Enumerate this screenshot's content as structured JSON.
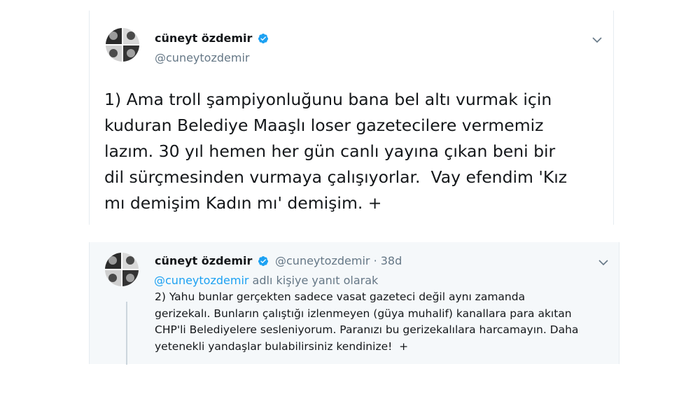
{
  "main_tweet": {
    "name": "cüneyt özdemir",
    "handle": "@cuneytozdemir",
    "text": "1) Ama troll şampiyonluğunu bana bel altı vurmak için\nkuduran Belediye Maaşlı loser gazetecilere vermemiz\nlazım. 30 yıl hemen her gün canlı yayına çıkan beni bir\ndil sürçmesinden vurmaya çalışıyorlar.  Vay efendim 'Kız\nmı demişim Kadın mı' demişim. +",
    "icons": [
      "avatar",
      "verified-badge-icon",
      "chevron-down-icon"
    ]
  },
  "reply_tweet": {
    "name": "cüneyt özdemir",
    "handle": "@cuneytozdemir",
    "separator": "·",
    "time": "38d",
    "reply_to_handle": "@cuneytozdemir",
    "reply_to_suffix": " adlı kişiye yanıt olarak",
    "text": "2) Yahu bunlar gerçekten sadece vasat gazeteci değil aynı zamanda\ngerizekalı. Bunların çalıştığı izlenmeyen (güya muhalif) kanallara para akıtan\nCHP'li Belediyelere sesleniyorum. Paranızı bu gerizekalılara harcamayın. Daha\nyetenekli yandaşlar bulabilirsiniz kendinize!  +",
    "icons": [
      "avatar",
      "verified-badge-icon",
      "chevron-down-icon"
    ]
  },
  "colors": {
    "verified_blue": "#1da1f2",
    "link_blue": "#1da1f2",
    "secondary_text": "#657786",
    "reply_background": "#f5f8fa"
  }
}
